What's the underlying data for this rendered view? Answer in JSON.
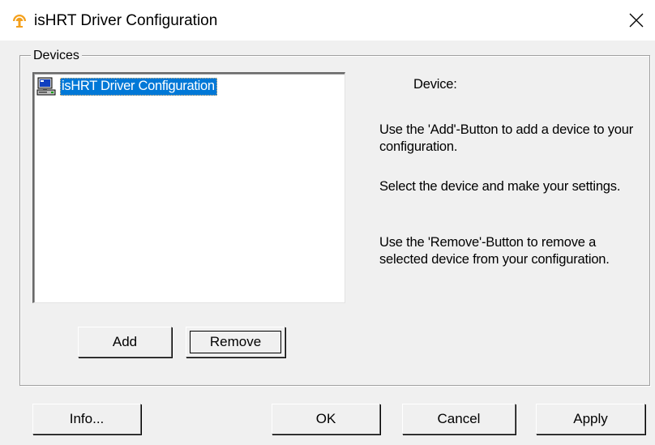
{
  "window": {
    "title": "isHRT Driver Configuration",
    "icon": "ishrt-app-icon",
    "close_icon": "close-icon"
  },
  "devices_group": {
    "label": "Devices",
    "list": {
      "items": [
        {
          "label": "isHRT Driver Configuration",
          "icon": "computer-icon",
          "selected": true
        }
      ]
    },
    "description": {
      "title": "Device:",
      "paragraphs": [
        "Use the 'Add'-Button to add a device to your configuration.",
        "Select the device and make your settings.",
        "Use the 'Remove'-Button to remove a selected device from your configuration."
      ]
    },
    "buttons": {
      "add": "Add",
      "remove": "Remove"
    }
  },
  "footer": {
    "info": "Info...",
    "ok": "OK",
    "cancel": "Cancel",
    "apply": "Apply"
  },
  "colors": {
    "window_bg": "#f0f0f0",
    "selection": "#0078d7",
    "icon_orange": "#f4a01c"
  }
}
